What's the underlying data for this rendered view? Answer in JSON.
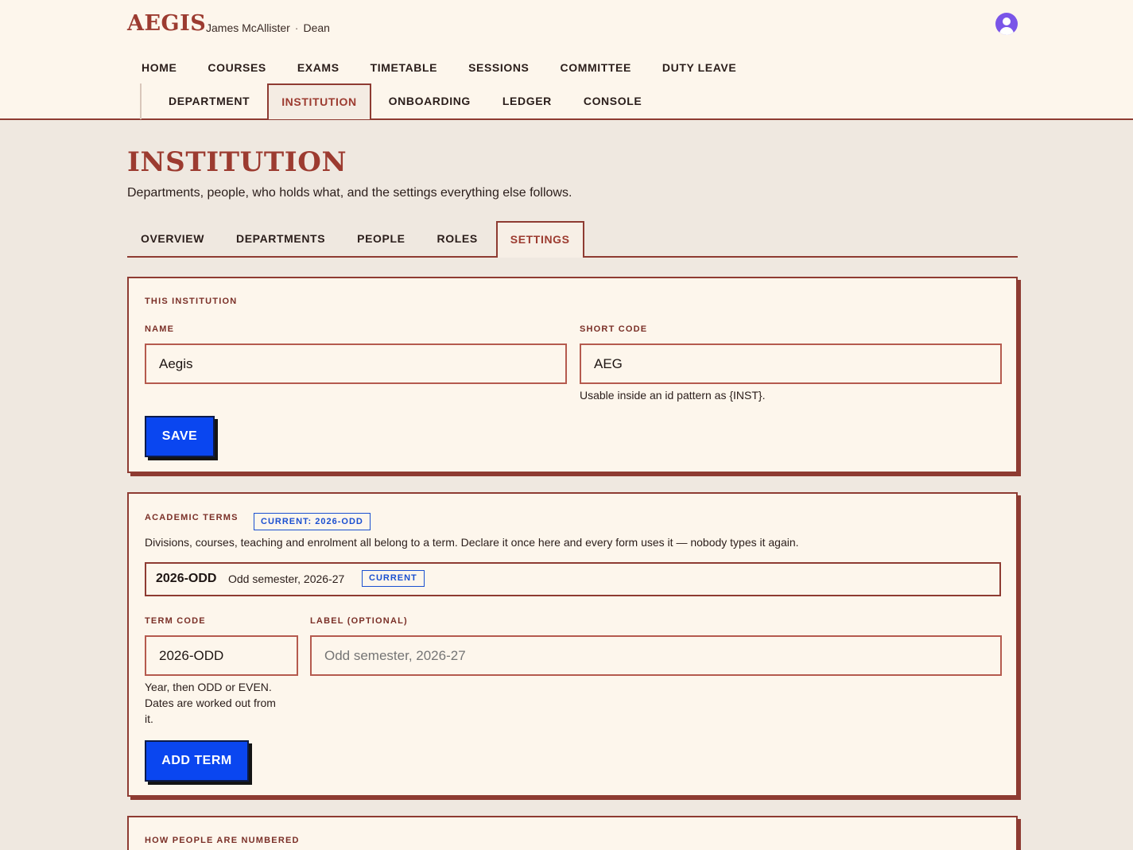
{
  "app": {
    "logo": "AEGIS",
    "user_name": "James McAllister",
    "user_separator": "·",
    "user_role": "Dean"
  },
  "nav": {
    "items": [
      {
        "label": "HOME"
      },
      {
        "label": "COURSES"
      },
      {
        "label": "EXAMS"
      },
      {
        "label": "TIMETABLE"
      },
      {
        "label": "SESSIONS"
      },
      {
        "label": "COMMITTEE"
      },
      {
        "label": "DUTY LEAVE"
      }
    ]
  },
  "subnav": {
    "items": [
      {
        "label": "DEPARTMENT",
        "active": false
      },
      {
        "label": "INSTITUTION",
        "active": true
      },
      {
        "label": "ONBOARDING",
        "active": false
      },
      {
        "label": "LEDGER",
        "active": false
      },
      {
        "label": "CONSOLE",
        "active": false
      }
    ]
  },
  "page": {
    "title": "INSTITUTION",
    "subtitle": "Departments, people, who holds what, and the settings everything else follows."
  },
  "tabs": {
    "items": [
      {
        "label": "OVERVIEW",
        "active": false
      },
      {
        "label": "DEPARTMENTS",
        "active": false
      },
      {
        "label": "PEOPLE",
        "active": false
      },
      {
        "label": "ROLES",
        "active": false
      },
      {
        "label": "SETTINGS",
        "active": true
      }
    ]
  },
  "institution_card": {
    "heading": "THIS INSTITUTION",
    "name_label": "NAME",
    "name_value": "Aegis",
    "short_code_label": "SHORT CODE",
    "short_code_value": "AEG",
    "short_code_help": "Usable inside an id pattern as {INST}.",
    "save_label": "SAVE"
  },
  "terms_card": {
    "heading": "ACADEMIC TERMS",
    "current_badge": "CURRENT: 2026-ODD",
    "description": "Divisions, courses, teaching and enrolment all belong to a term. Declare it once here and every form uses it — nobody types it again.",
    "terms": [
      {
        "code": "2026-ODD",
        "label": "Odd semester, 2026-27",
        "badge": "CURRENT"
      }
    ],
    "term_code_label": "TERM CODE",
    "term_code_value": "2026-ODD",
    "term_code_help_1": "Year, then ODD or EVEN.",
    "term_code_help_2": "Dates are worked out from",
    "term_code_help_3": "it.",
    "label_label": "LABEL (OPTIONAL)",
    "label_placeholder": "Odd semester, 2026-27",
    "add_label": "ADD TERM"
  },
  "numbering_card": {
    "heading": "HOW PEOPLE ARE NUMBERED"
  },
  "colors": {
    "brand": "#9c3b30",
    "accent_button": "#0a46f0",
    "badge_blue": "#1a4fd0",
    "background": "#efe8e0",
    "surface": "#fdf6ec"
  },
  "icons": {
    "avatar": "user-avatar-icon"
  }
}
